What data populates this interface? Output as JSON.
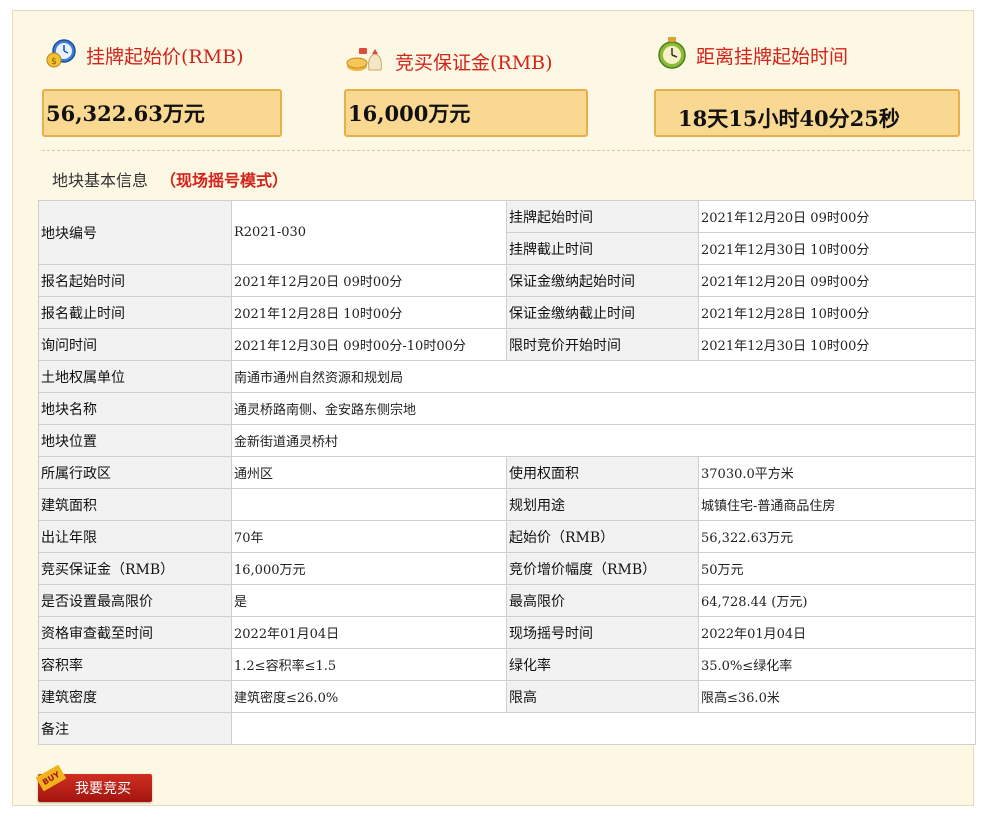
{
  "stats": [
    {
      "title": "挂牌起始价(RMB)",
      "value": "56,322.63万元",
      "icon": "money-clock-icon"
    },
    {
      "title": "竞买保证金(RMB)",
      "value": "16,000万元",
      "icon": "coins-bag-icon"
    },
    {
      "title": "距离挂牌起始时间",
      "value": "18天15小时40分25秒",
      "icon": "alarm-clock-icon"
    }
  ],
  "section": {
    "title": "地块基本信息",
    "mode": "（现场摇号模式）"
  },
  "rows": {
    "r1": {
      "label": "地块编号",
      "value": "R2021-030",
      "sub": [
        {
          "label": "挂牌起始时间",
          "value": "2021年12月20日 09时00分"
        },
        {
          "label": "挂牌截止时间",
          "value": "2021年12月30日 10时00分"
        }
      ]
    },
    "r2": {
      "l1": "报名起始时间",
      "v1": "2021年12月20日 09时00分",
      "l2": "保证金缴纳起始时间",
      "v2": "2021年12月20日 09时00分"
    },
    "r3": {
      "l1": "报名截止时间",
      "v1": "2021年12月28日 10时00分",
      "l2": "保证金缴纳截止时间",
      "v2": "2021年12月28日 10时00分"
    },
    "r4": {
      "l1": "询问时间",
      "v1": "2021年12月30日 09时00分-10时00分",
      "l2": "限时竞价开始时间",
      "v2": "2021年12月30日 10时00分"
    },
    "r5": {
      "l1": "土地权属单位",
      "v1": "南通市通州自然资源和规划局"
    },
    "r6": {
      "l1": "地块名称",
      "v1": "通灵桥路南侧、金安路东侧宗地"
    },
    "r7": {
      "l1": "地块位置",
      "v1": "金新街道通灵桥村"
    },
    "r8": {
      "l1": "所属行政区",
      "v1": "通州区",
      "l2": "使用权面积",
      "v2": "37030.0平方米"
    },
    "r9": {
      "l1": "建筑面积",
      "v1": "",
      "l2": "规划用途",
      "v2": "城镇住宅-普通商品住房"
    },
    "r10": {
      "l1": "出让年限",
      "v1": "70年",
      "l2": "起始价（RMB）",
      "v2": "56,322.63万元"
    },
    "r11": {
      "l1": "竞买保证金（RMB）",
      "v1": "16,000万元",
      "l2": "竞价增价幅度（RMB）",
      "v2": "50万元"
    },
    "r12": {
      "l1": "是否设置最高限价",
      "v1": "是",
      "l2": "最高限价",
      "v2": "64,728.44 (万元)"
    },
    "r13": {
      "l1": "资格审查截至时间",
      "v1": "2022年01月04日",
      "l2": "现场摇号时间",
      "v2": "2022年01月04日"
    },
    "r14": {
      "l1": "容积率",
      "v1": "1.2≤容积率≤1.5",
      "l2": "绿化率",
      "v2": "35.0%≤绿化率"
    },
    "r15": {
      "l1": "建筑密度",
      "v1": "建筑密度≤26.0%",
      "l2": "限高",
      "v2": "限高≤36.0米"
    },
    "r16": {
      "l1": "备注",
      "v1": ""
    }
  },
  "buy": {
    "label": "我要竞买",
    "tag": "BUY"
  },
  "colors": {
    "accent": "#d3231b",
    "box_fill": "#f9d992",
    "box_border": "#e7b04c",
    "panel_bg": "#fdf8e4"
  }
}
